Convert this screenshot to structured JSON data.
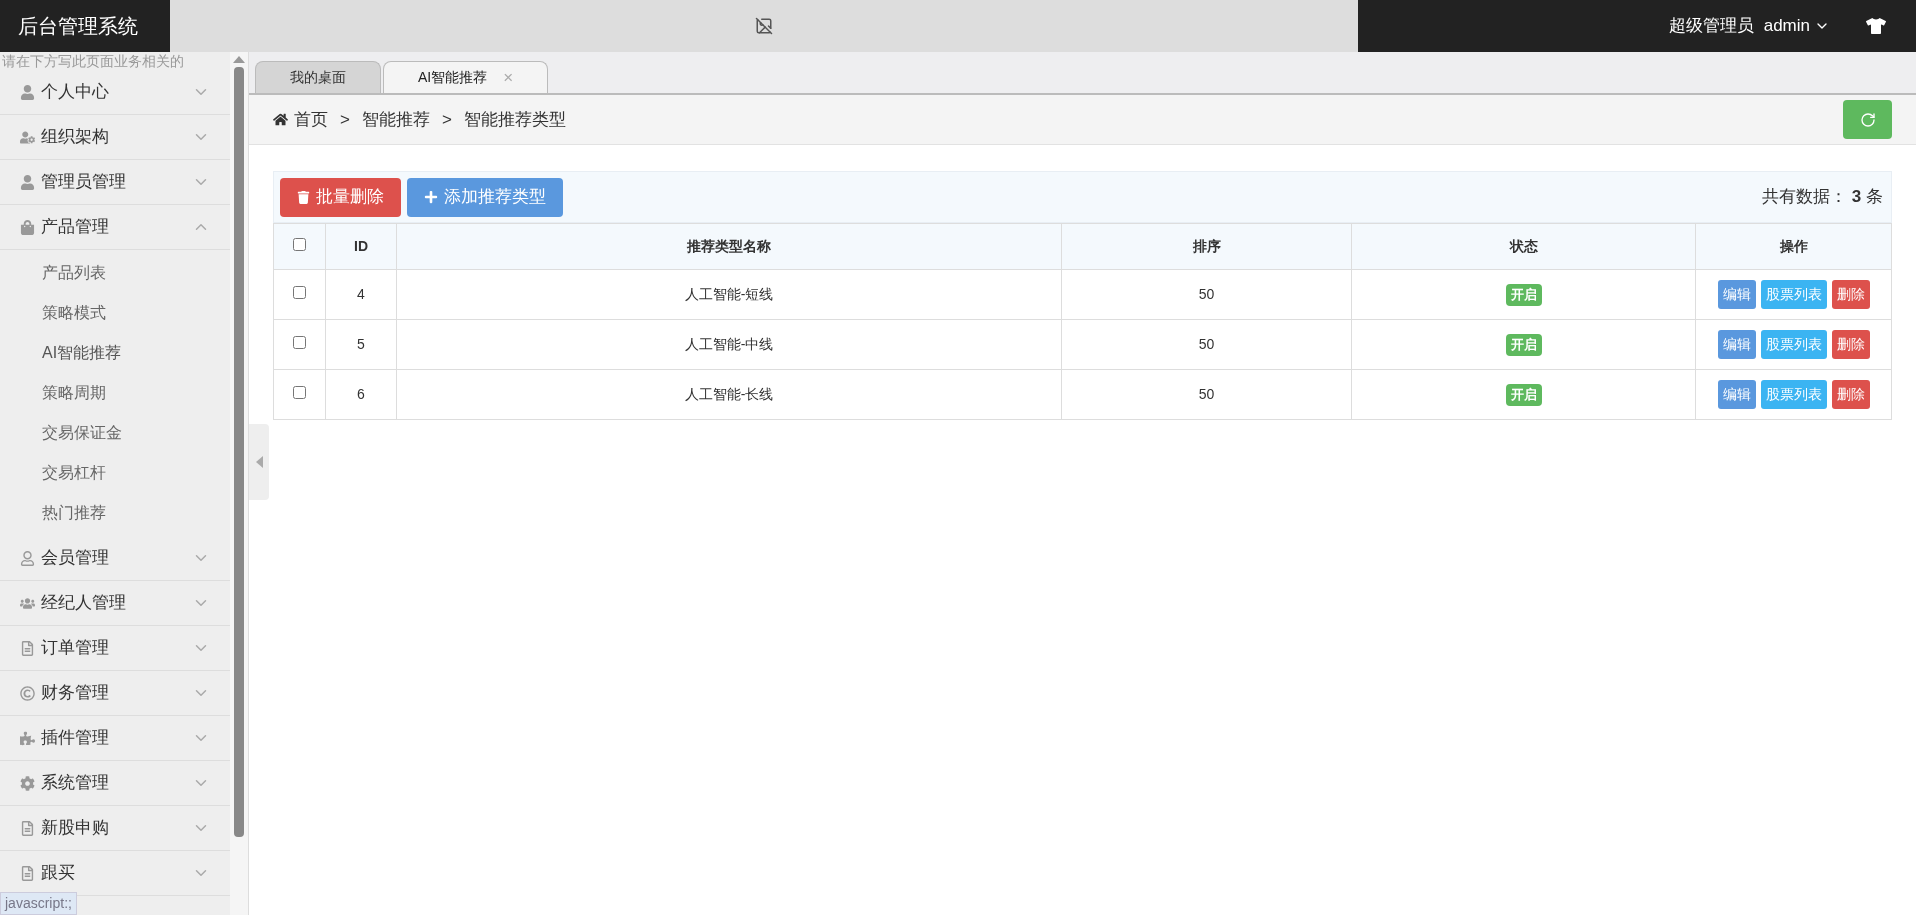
{
  "header": {
    "logo": "后台管理系统",
    "role": "超级管理员",
    "user": "admin"
  },
  "sidebar": {
    "hint": "请在下方写此页面业务相关的",
    "items": [
      {
        "kind": "person",
        "label": "个人中心",
        "expanded": false
      },
      {
        "kind": "org",
        "label": "组织架构",
        "expanded": false
      },
      {
        "kind": "person",
        "label": "管理员管理",
        "expanded": false
      },
      {
        "kind": "bag",
        "label": "产品管理",
        "expanded": true,
        "children": [
          {
            "label": "产品列表",
            "selected": false
          },
          {
            "label": "策略模式",
            "selected": false
          },
          {
            "label": "AI智能推荐",
            "selected": true
          },
          {
            "label": "策略周期",
            "selected": false
          },
          {
            "label": "交易保证金",
            "selected": false
          },
          {
            "label": "交易杠杆",
            "selected": false
          },
          {
            "label": "热门推荐",
            "selected": false
          }
        ]
      },
      {
        "kind": "user",
        "label": "会员管理",
        "expanded": false
      },
      {
        "kind": "group",
        "label": "经纪人管理",
        "expanded": false
      },
      {
        "kind": "doc",
        "label": "订单管理",
        "expanded": false
      },
      {
        "kind": "coin",
        "label": "财务管理",
        "expanded": false
      },
      {
        "kind": "puzzle",
        "label": "插件管理",
        "expanded": false
      },
      {
        "kind": "gear",
        "label": "系统管理",
        "expanded": false
      },
      {
        "kind": "doc",
        "label": "新股申购",
        "expanded": false
      },
      {
        "kind": "doc",
        "label": "跟买",
        "expanded": false
      }
    ]
  },
  "status_bar": "javascript:;",
  "tabs": [
    {
      "label": "我的桌面",
      "selected": false,
      "closable": false
    },
    {
      "label": "AI智能推荐",
      "selected": true,
      "closable": true
    }
  ],
  "tab_close": "×",
  "breadcrumb": [
    "首页",
    "智能推荐",
    "智能推荐类型"
  ],
  "breadcrumb_separator": ">",
  "toolbar": {
    "buttons": [
      {
        "kind": "danger",
        "label": "批量删除"
      },
      {
        "kind": "primary",
        "label": "添加推荐类型"
      }
    ],
    "total_prefix": "共有数据：",
    "total": "3",
    "total_suffix": "条"
  },
  "table": {
    "all_checked": false,
    "columns": [
      "ID",
      "推荐类型名称",
      "排序",
      "状态",
      "操作"
    ],
    "rows": [
      {
        "checked": false,
        "id": "4",
        "name": "人工智能-短线",
        "sort": "50",
        "status": "开启",
        "status_on": true,
        "actions": [
          {
            "kind": "edit",
            "label": "编辑"
          },
          {
            "kind": "info",
            "label": "股票列表"
          },
          {
            "kind": "danger",
            "label": "删除"
          }
        ]
      },
      {
        "checked": false,
        "id": "5",
        "name": "人工智能-中线",
        "sort": "50",
        "status": "开启",
        "status_on": true,
        "actions": [
          {
            "kind": "edit",
            "label": "编辑"
          },
          {
            "kind": "info",
            "label": "股票列表"
          },
          {
            "kind": "danger",
            "label": "删除"
          }
        ]
      },
      {
        "checked": false,
        "id": "6",
        "name": "人工智能-长线",
        "sort": "50",
        "status": "开启",
        "status_on": true,
        "actions": [
          {
            "kind": "edit",
            "label": "编辑"
          },
          {
            "kind": "info",
            "label": "股票列表"
          },
          {
            "kind": "danger",
            "label": "删除"
          }
        ]
      }
    ]
  }
}
